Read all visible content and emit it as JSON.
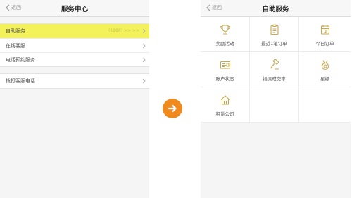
{
  "left": {
    "back_label": "返回",
    "title": "服务中心",
    "group1": [
      {
        "label": "自助服务",
        "value": "(1888)  >>  >>"
      },
      {
        "label": "在线客服"
      },
      {
        "label": "电话预约服务"
      }
    ],
    "group2": [
      {
        "label": "拨打客服电话"
      }
    ]
  },
  "right": {
    "back_label": "返回",
    "title": "自助服务",
    "tiles": [
      {
        "label": "奖励活动",
        "icon": "trophy-icon"
      },
      {
        "label": "最近1笔订单",
        "icon": "clipboard-icon"
      },
      {
        "label": "今日订单",
        "icon": "calendar-icon"
      },
      {
        "label": "账户状态",
        "icon": "id-card-icon"
      },
      {
        "label": "指派成交率",
        "icon": "gavel-icon"
      },
      {
        "label": "星级",
        "icon": "medal-icon"
      },
      {
        "label": "租赁公司",
        "icon": "house-icon"
      }
    ]
  },
  "colors": {
    "highlight": "#f3f25b",
    "accent_arrow": "#f08a1c",
    "icon_gold": "#c9a84a"
  }
}
